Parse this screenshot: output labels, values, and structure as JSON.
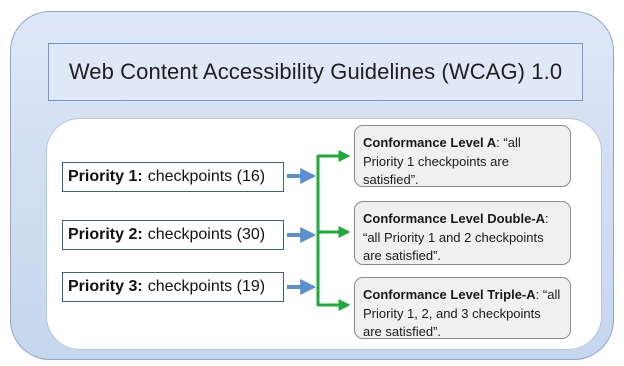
{
  "title": "Web Content Accessibility Guidelines (WCAG) 1.0",
  "priorities": [
    {
      "label": "Priority 1:",
      "text": "checkpoints (16)"
    },
    {
      "label": "Priority 2:",
      "text": "checkpoints (30)"
    },
    {
      "label": "Priority 3:",
      "text": "checkpoints (19)"
    }
  ],
  "conformance": [
    {
      "level": "Conformance Level A",
      "text": ": “all Priority 1 checkpoints are satisfied”."
    },
    {
      "level": "Conformance Level Double-A",
      "text": ": “all Priority 1 and 2 checkpoints are satisfied”."
    },
    {
      "level": "Conformance Level Triple-A",
      "text": ": “all Priority 1, 2, and 3 checkpoints are satisfied”."
    }
  ],
  "colors": {
    "blue_arrow": "#5b8fd0",
    "green_connector": "#1faa3a"
  }
}
